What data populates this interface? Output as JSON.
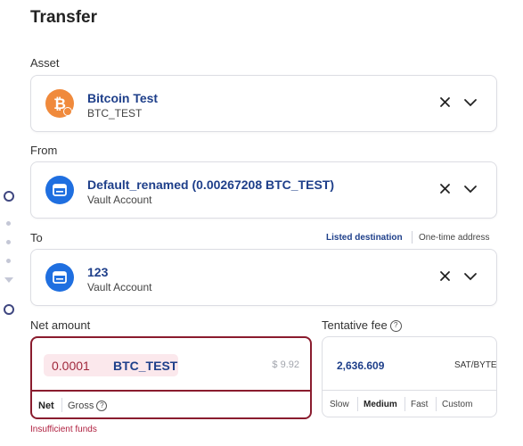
{
  "header": {
    "title": "Transfer"
  },
  "asset": {
    "label": "Asset",
    "name": "Bitcoin Test",
    "code": "BTC_TEST"
  },
  "from": {
    "label": "From",
    "name": "Default_renamed (0.00267208 BTC_TEST)",
    "type": "Vault Account"
  },
  "to": {
    "label": "To",
    "toggle": {
      "listed": "Listed destination",
      "one_time": "One-time address"
    },
    "name": "123",
    "type": "Vault Account"
  },
  "net_amount": {
    "label": "Net amount",
    "value": "0.0001",
    "currency": "BTC_TEST",
    "usd": "$ 9.92",
    "tabs": {
      "net": "Net",
      "gross": "Gross"
    },
    "error": "Insufficient funds"
  },
  "fee": {
    "label": "Tentative fee",
    "value": "2,636.609",
    "unit": "SAT/BYTE",
    "speeds": [
      "Slow",
      "Medium",
      "Fast",
      "Custom"
    ],
    "selected": "Medium"
  },
  "colors": {
    "accent": "#1e3f8a",
    "error": "#8a1c2e",
    "btc": "#f08a3c",
    "vault": "#1f6fe0"
  },
  "icons": {
    "asset": "bitcoin-icon",
    "vault": "vault-icon",
    "clear": "close-icon",
    "expand": "chevron-down-icon",
    "help": "question-circle-icon"
  }
}
